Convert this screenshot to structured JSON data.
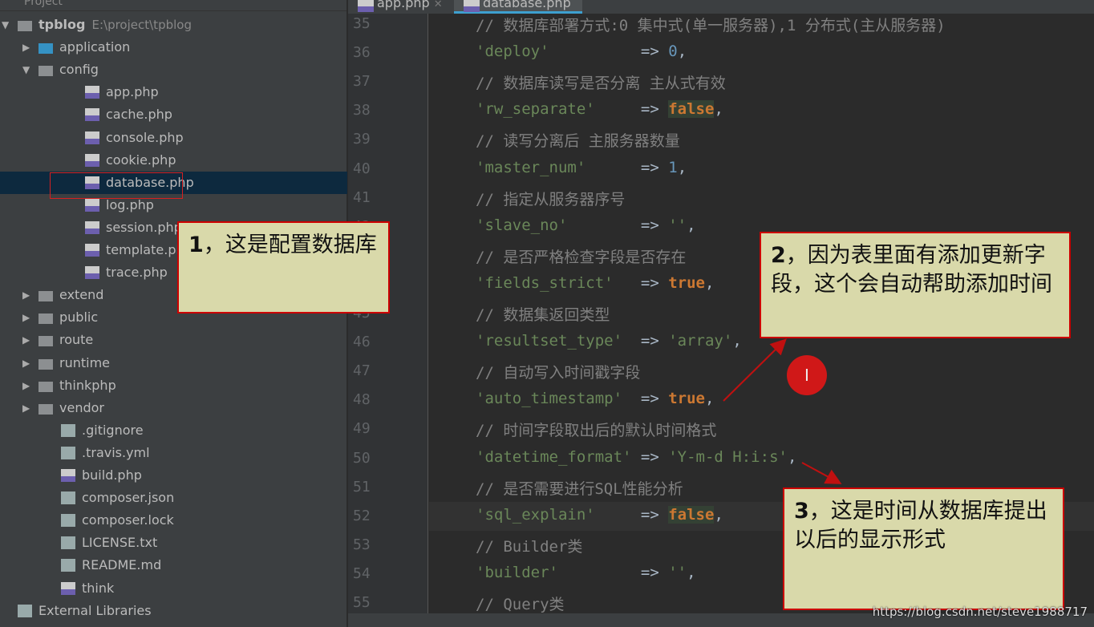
{
  "sidebar": {
    "title": "Project",
    "tree": [
      {
        "label": "tpblog",
        "path": "E:\\project\\tpblog",
        "type": "folder",
        "depth": 0,
        "open": true
      },
      {
        "label": "application",
        "type": "folder-blue",
        "depth": 1,
        "open": false
      },
      {
        "label": "config",
        "type": "folder",
        "depth": 1,
        "open": true
      },
      {
        "label": "app.php",
        "type": "php",
        "depth": 2
      },
      {
        "label": "cache.php",
        "type": "php",
        "depth": 2
      },
      {
        "label": "console.php",
        "type": "php",
        "depth": 2
      },
      {
        "label": "cookie.php",
        "type": "php",
        "depth": 2
      },
      {
        "label": "database.php",
        "type": "php",
        "depth": 2,
        "selected": true
      },
      {
        "label": "log.php",
        "type": "php",
        "depth": 2
      },
      {
        "label": "session.php",
        "type": "php",
        "depth": 2
      },
      {
        "label": "template.php",
        "type": "php",
        "depth": 2
      },
      {
        "label": "trace.php",
        "type": "php",
        "depth": 2
      },
      {
        "label": "extend",
        "type": "folder",
        "depth": 1,
        "open": false
      },
      {
        "label": "public",
        "type": "folder",
        "depth": 1,
        "open": false
      },
      {
        "label": "route",
        "type": "folder",
        "depth": 1,
        "open": false
      },
      {
        "label": "runtime",
        "type": "folder",
        "depth": 1,
        "open": false
      },
      {
        "label": "thinkphp",
        "type": "folder",
        "depth": 1,
        "open": false
      },
      {
        "label": "vendor",
        "type": "folder",
        "depth": 1,
        "open": false
      },
      {
        "label": ".gitignore",
        "type": "file",
        "depth": 1
      },
      {
        "label": ".travis.yml",
        "type": "file",
        "depth": 1
      },
      {
        "label": "build.php",
        "type": "php",
        "depth": 1
      },
      {
        "label": "composer.json",
        "type": "file",
        "depth": 1
      },
      {
        "label": "composer.lock",
        "type": "file",
        "depth": 1
      },
      {
        "label": "LICENSE.txt",
        "type": "file",
        "depth": 1
      },
      {
        "label": "README.md",
        "type": "file",
        "depth": 1
      },
      {
        "label": "think",
        "type": "php",
        "depth": 1
      },
      {
        "label": "External Libraries",
        "type": "lib",
        "depth": 0
      }
    ]
  },
  "tabs": [
    {
      "label": "app.php",
      "active": false
    },
    {
      "label": "database.php",
      "active": true
    }
  ],
  "code": [
    {
      "n": "35",
      "parts": [
        [
          "cm",
          "// 数据库部署方式:0 集中式(单一服务器),1 分布式(主从服务器)"
        ]
      ]
    },
    {
      "n": "36",
      "parts": [
        [
          "st",
          "'deploy'"
        ],
        [
          "op",
          "          => "
        ],
        [
          "nu",
          "0"
        ],
        [
          "op",
          ","
        ]
      ]
    },
    {
      "n": "37",
      "parts": [
        [
          "cm",
          "// 数据库读写是否分离 主从式有效"
        ]
      ]
    },
    {
      "n": "38",
      "parts": [
        [
          "st",
          "'rw_separate'"
        ],
        [
          "op",
          "     => "
        ],
        [
          "kw kwbg",
          "false"
        ],
        [
          "op",
          ","
        ]
      ]
    },
    {
      "n": "39",
      "parts": [
        [
          "cm",
          "// 读写分离后 主服务器数量"
        ]
      ]
    },
    {
      "n": "40",
      "parts": [
        [
          "st",
          "'master_num'"
        ],
        [
          "op",
          "      => "
        ],
        [
          "nu",
          "1"
        ],
        [
          "op",
          ","
        ]
      ]
    },
    {
      "n": "41",
      "parts": [
        [
          "cm",
          "// 指定从服务器序号"
        ]
      ]
    },
    {
      "n": "42",
      "parts": [
        [
          "st",
          "'slave_no'"
        ],
        [
          "op",
          "        => "
        ],
        [
          "st",
          "''"
        ],
        [
          "op",
          ","
        ]
      ]
    },
    {
      "n": "43",
      "parts": [
        [
          "cm",
          "// 是否严格检查字段是否存在"
        ]
      ]
    },
    {
      "n": "44",
      "parts": [
        [
          "st",
          "'fields_strict'"
        ],
        [
          "op",
          "   => "
        ],
        [
          "kw",
          "true"
        ],
        [
          "op",
          ","
        ]
      ]
    },
    {
      "n": "45",
      "parts": [
        [
          "cm",
          "// 数据集返回类型"
        ]
      ]
    },
    {
      "n": "46",
      "parts": [
        [
          "st",
          "'resultset_type'"
        ],
        [
          "op",
          "  => "
        ],
        [
          "st",
          "'array'"
        ],
        [
          "op",
          ","
        ]
      ]
    },
    {
      "n": "47",
      "parts": [
        [
          "cm",
          "// 自动写入时间戳字段"
        ]
      ]
    },
    {
      "n": "48",
      "parts": [
        [
          "st",
          "'auto_timestamp'"
        ],
        [
          "op",
          "  => "
        ],
        [
          "kw",
          "true"
        ],
        [
          "op",
          ","
        ]
      ]
    },
    {
      "n": "49",
      "parts": [
        [
          "cm",
          "// 时间字段取出后的默认时间格式"
        ]
      ]
    },
    {
      "n": "50",
      "parts": [
        [
          "st",
          "'datetime_format'"
        ],
        [
          "op",
          " => "
        ],
        [
          "st",
          "'Y-m-d H:i:s'"
        ],
        [
          "op",
          ","
        ]
      ]
    },
    {
      "n": "51",
      "parts": [
        [
          "cm",
          "// 是否需要进行SQL性能分析"
        ]
      ]
    },
    {
      "n": "52",
      "parts": [
        [
          "st",
          "'sql_explain'"
        ],
        [
          "op",
          "     => "
        ],
        [
          "kw kwbg",
          "false"
        ],
        [
          "op",
          ","
        ]
      ],
      "current": true
    },
    {
      "n": "53",
      "parts": [
        [
          "cm",
          "// Builder类"
        ]
      ]
    },
    {
      "n": "54",
      "parts": [
        [
          "st",
          "'builder'"
        ],
        [
          "op",
          "         => "
        ],
        [
          "st",
          "''"
        ],
        [
          "op",
          ","
        ]
      ]
    },
    {
      "n": "55",
      "parts": [
        [
          "cm",
          "// Query类"
        ]
      ]
    }
  ],
  "notes": {
    "n1": {
      "num": "1",
      "text": "，这是配置数据库"
    },
    "n2": {
      "num": "2",
      "text": "，因为表里面有添加更新字段，这个会自动帮助添加时间"
    },
    "n3": {
      "num": "3",
      "text": "，这是时间从数据库提出以后的显示形式"
    }
  },
  "cursor_glyph": "I",
  "watermark": "https://blog.csdn.net/steve1988717",
  "colors": {
    "annotation_border": "#cc0000",
    "annotation_bg": "#d9d9aa",
    "selection": "#0d293e"
  }
}
